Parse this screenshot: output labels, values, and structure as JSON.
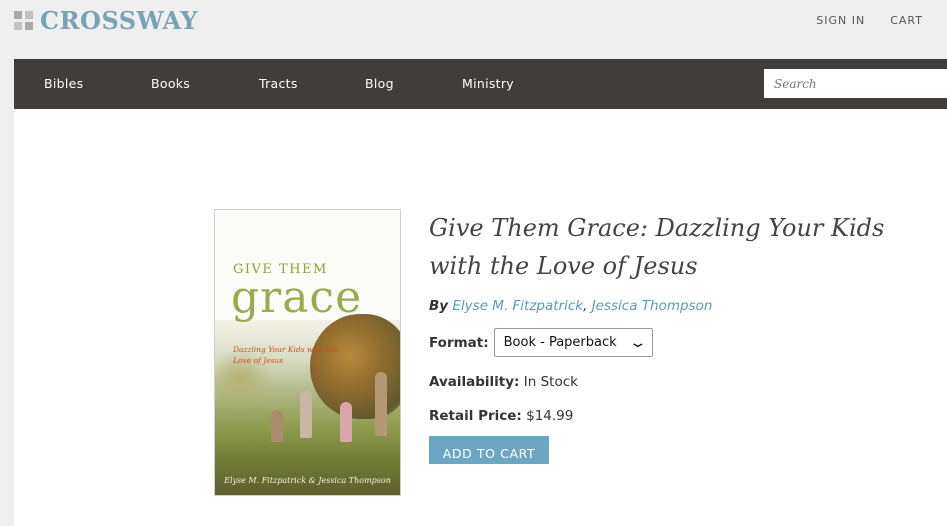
{
  "header": {
    "logo_text": "CROSSWAY",
    "sign_in": "SIGN IN",
    "cart": "CART"
  },
  "nav": {
    "items": [
      "Bibles",
      "Books",
      "Tracts",
      "Blog",
      "Ministry"
    ],
    "search_placeholder": "Search"
  },
  "product": {
    "cover": {
      "title_small": "GIVE THEM",
      "title_big": "grace",
      "subtitle": "Dazzling Your Kids with the Love of Jesus",
      "authors": "Elyse M. Fitzpatrick & Jessica Thompson"
    },
    "title": "Give Them Grace: Dazzling Your Kids with the Love of Jesus",
    "by_label": "By",
    "authors": [
      "Elyse M. Fitzpatrick",
      "Jessica Thompson"
    ],
    "author_separator": ",",
    "format_label": "Format:",
    "format_value": "Book - Paperback",
    "availability_label": "Availability:",
    "availability_value": "In Stock",
    "price_label": "Retail Price:",
    "price_value": "$14.99",
    "add_to_cart": "ADD TO CART"
  },
  "colors": {
    "accent": "#6da6c4",
    "nav_bg": "#403d3b",
    "logo": "#7aa2b5",
    "link": "#5c9ab9"
  }
}
